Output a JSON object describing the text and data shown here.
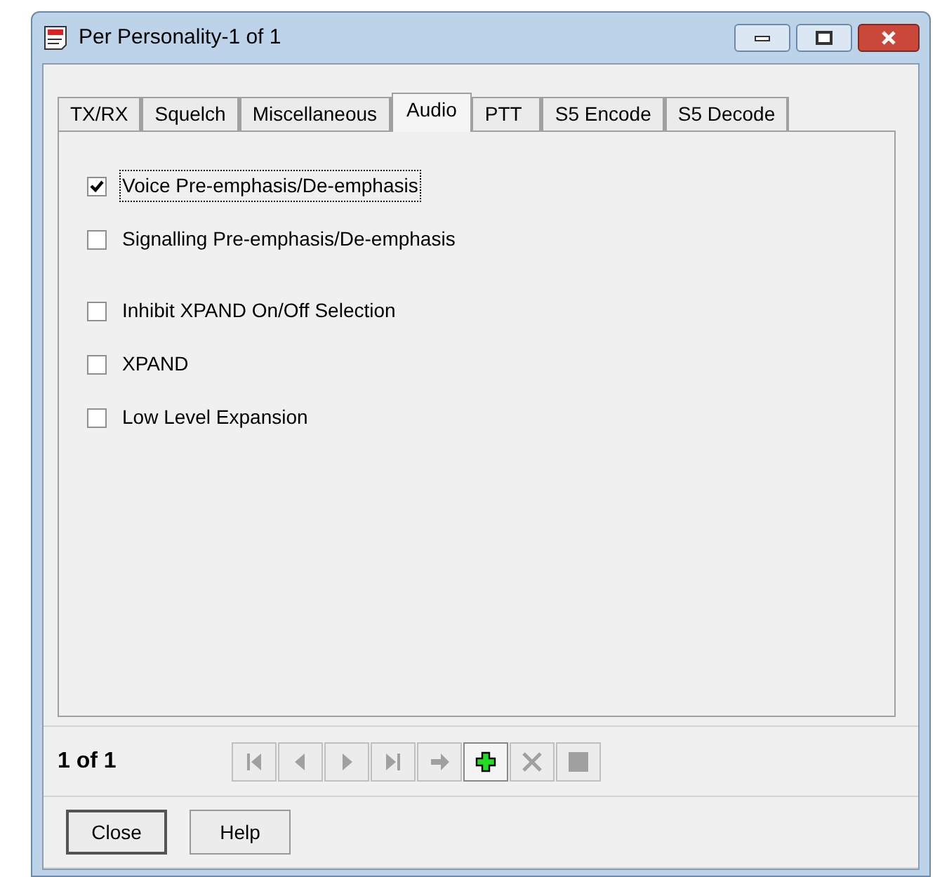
{
  "window": {
    "title": "Per Personality-1 of 1"
  },
  "tabs": [
    {
      "label": "TX/RX",
      "selected": false
    },
    {
      "label": "Squelch",
      "selected": false
    },
    {
      "label": "Miscellaneous",
      "selected": false
    },
    {
      "label": "Audio",
      "selected": true
    },
    {
      "label": "PTT",
      "selected": false
    },
    {
      "label": "S5 Encode",
      "selected": false
    },
    {
      "label": "S5 Decode",
      "selected": false
    }
  ],
  "checkbox_groups": [
    [
      {
        "label": "Voice Pre-emphasis/De-emphasis",
        "checked": true,
        "focused": true
      },
      {
        "label": "Signalling Pre-emphasis/De-emphasis",
        "checked": false,
        "focused": false
      }
    ],
    [
      {
        "label": "Inhibit XPAND On/Off Selection",
        "checked": false,
        "focused": false
      },
      {
        "label": "XPAND",
        "checked": false,
        "focused": false
      },
      {
        "label": "Low Level Expansion",
        "checked": false,
        "focused": false
      }
    ]
  ],
  "record_counter": "1 of 1",
  "nav_buttons": [
    {
      "kind": "first",
      "disabled": true
    },
    {
      "kind": "previous",
      "disabled": true
    },
    {
      "kind": "next",
      "disabled": true
    },
    {
      "kind": "last",
      "disabled": true
    },
    {
      "kind": "goto",
      "disabled": true
    },
    {
      "kind": "add",
      "disabled": false
    },
    {
      "kind": "delete",
      "disabled": true
    },
    {
      "kind": "stop",
      "disabled": true
    }
  ],
  "buttons": [
    {
      "label": "Close",
      "default": true
    },
    {
      "label": "Help",
      "default": false
    }
  ]
}
